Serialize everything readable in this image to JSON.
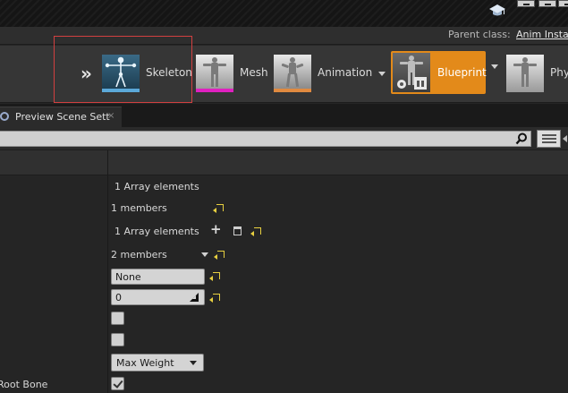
{
  "header": {
    "parent_class_label": "Parent class:",
    "parent_class_value": "Anim Insta"
  },
  "modes": [
    {
      "label": "Skeleton",
      "icon": "skeleton-figure-icon",
      "accent": "#5ba8d8"
    },
    {
      "label": "Mesh",
      "icon": "mesh-figure-icon",
      "accent": "#e020c0"
    },
    {
      "label": "Animation",
      "icon": "animation-figure-icon",
      "accent": "#e08a40"
    },
    {
      "label": "Blueprint",
      "icon": "blueprint-figure-icon",
      "active": true,
      "accent": "#e38a1a"
    },
    {
      "label": "Phy",
      "icon": "physics-figure-icon"
    }
  ],
  "tab": {
    "label": "Preview Scene Sett",
    "close": "×"
  },
  "search": {
    "value": "",
    "placeholder": ""
  },
  "details": {
    "rows": [
      {
        "value": "1 Array elements"
      },
      {
        "value": "1 members"
      },
      {
        "value": "1 Array elements"
      },
      {
        "value": "2 members"
      },
      {
        "field": "None"
      },
      {
        "field": "0"
      },
      {
        "checkbox": false
      },
      {
        "checkbox": false
      },
      {
        "combo": "Max Weight"
      },
      {
        "label": "Root Bone",
        "checkbox": true
      }
    ]
  },
  "icons": {
    "plus": "+",
    "chevrons": "»"
  }
}
